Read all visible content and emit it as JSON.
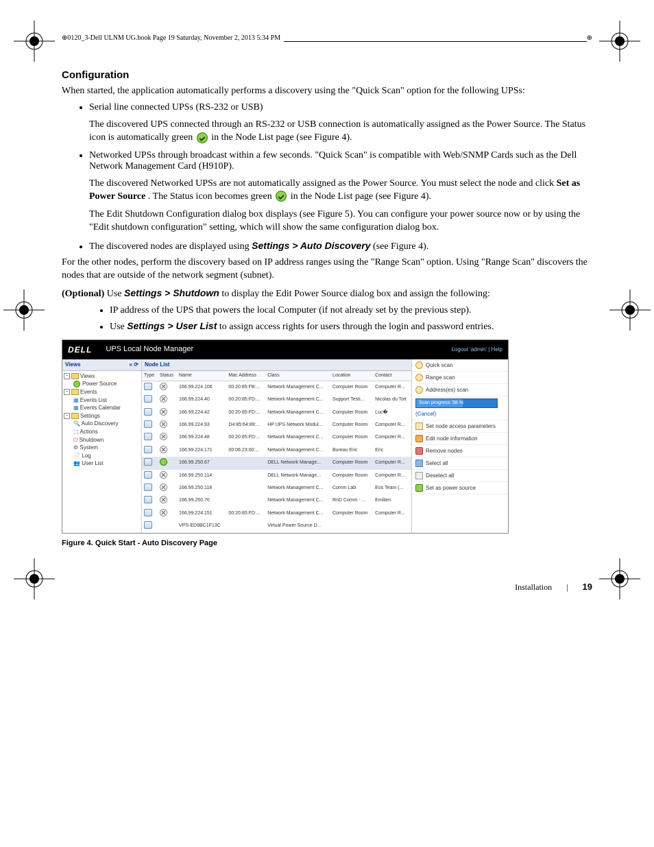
{
  "running_head": "0120_3-Dell ULNM UG.book  Page 19  Saturday, November 2, 2013  5:34 PM",
  "section_heading": "Configuration",
  "intro": "When started, the application automatically performs a discovery using the \"Quick Scan\" option for the following UPSs:",
  "bullet1_title": "Serial line connected UPSs (RS-232 or USB)",
  "bullet1_p1a": "The discovered UPS connected through an RS-232 or USB connection is automatically assigned as the Power Source. The Status icon is automatically green ",
  "bullet1_p1b": " in the Node List page (see Figure 4).",
  "bullet2_title": "Networked UPSs through broadcast within a few seconds. \"Quick Scan\" is compatible with Web/SNMP Cards such as the Dell Network Management Card (H910P).",
  "bullet2_p1a": "The discovered Networked UPSs are not automatically assigned as the Power Source. You must select the node and click ",
  "bullet2_p1_bold": "Set as Power Source",
  "bullet2_p1b": ". The Status icon becomes green ",
  "bullet2_p1c": " in the Node List page (see Figure 4).",
  "bullet2_p2": "The Edit Shutdown Configuration dialog box displays (see Figure 5). You can configure your power source now or by using the \"Edit shutdown configuration\" setting, which will show the same configuration dialog box.",
  "bullet3a": "The discovered nodes are displayed using ",
  "bullet3_path": "Settings > Auto Discovery",
  "bullet3b": " (see Figure 4).",
  "para2": "For the other nodes, perform the discovery based on IP address ranges using the \"Range Scan\" option. Using \"Range Scan\" discovers the nodes that are outside of the network segment (subnet).",
  "para3a_bold": "(Optional)",
  "para3a": " Use ",
  "para3_path": "Settings > Shutdown",
  "para3b": " to display the Edit Power Source dialog box and assign the following:",
  "sub1": "IP address of the UPS that powers the local Computer (if not already set by the previous step).",
  "sub2a": "Use ",
  "sub2_path": "Settings > User List",
  "sub2b": " to assign access rights for users through the login and password entries.",
  "figure_caption": "Figure 4.  Quick Start - Auto Discovery Page",
  "footer_label": "Installation",
  "footer_page": "19",
  "app": {
    "logo": "DELL",
    "title": "UPS Local Node Manager",
    "header_right": "Logout 'admin'   |  Help",
    "sidebar_title": "Views",
    "sidebar": {
      "views": "Views",
      "power_source": "Power Source",
      "events": "Events",
      "events_list": "Events List",
      "events_calendar": "Events Calendar",
      "settings": "Settings",
      "auto_discovery": "Auto Discovery",
      "actions": "Actions",
      "shutdown": "Shutdown",
      "system": "System",
      "log": "Log",
      "user_list": "User List"
    },
    "nodelist_title": "Node List",
    "columns": [
      "Type",
      "Status",
      "Name",
      "Mac Address",
      "Class",
      "Location",
      "Contact"
    ],
    "rows": [
      {
        "name": "166.99.224.106",
        "mac": "00:20:85:FB:...",
        "class": "Network Management C...",
        "loc": "Computer Room",
        "contact": "Computer R..."
      },
      {
        "name": "166.99.224.40",
        "mac": "00:20:85:FD:...",
        "class": "Network Management C...",
        "loc": "Support Testi...",
        "contact": "Nicolas du Toit"
      },
      {
        "name": "166.99.224.42",
        "mac": "00:20:85:FD:...",
        "class": "Network Management C...",
        "loc": "Computer Room",
        "contact": "Luc�"
      },
      {
        "name": "166.99.224.93",
        "mac": "D4:85:64:89:...",
        "class": "HP UPS Network Modul...",
        "loc": "Computer Room",
        "contact": "Computer R..."
      },
      {
        "name": "166.99.224.48",
        "mac": "00:20:85:FD:...",
        "class": "Network Management C...",
        "loc": "Computer Room",
        "contact": "Computer R..."
      },
      {
        "name": "166.99.224.171",
        "mac": "00:06:23:00:...",
        "class": "Network Management C...",
        "loc": "Bureau Eric",
        "contact": "Eric"
      },
      {
        "name": "166.99.250.67",
        "mac": "",
        "class": "DELL Network Manage...",
        "loc": "Computer Room",
        "contact": "Computer R...",
        "sel": true,
        "ok": true
      },
      {
        "name": "166.99.250.114",
        "mac": "",
        "class": "DELL Network Manage...",
        "loc": "Computer Room",
        "contact": "Computer R..."
      },
      {
        "name": "166.99.250.118",
        "mac": "",
        "class": "Network Management C...",
        "loc": "Comm Lab",
        "contact": "Eos Team (..."
      },
      {
        "name": "166.99.250.70",
        "mac": "",
        "class": "Network Management C...",
        "loc": "RnD Comm - ...",
        "contact": "Emilien"
      },
      {
        "name": "166.99.224.151",
        "mac": "00:20:85:FD:...",
        "class": "Network Management C...",
        "loc": "Computer Room",
        "contact": "Computer R..."
      },
      {
        "name": "VPS-ED9BC1F13C",
        "mac": "",
        "class": "Virtual Power Source D...",
        "loc": "",
        "contact": "",
        "vps": true
      }
    ],
    "right": {
      "quick_scan": "Quick scan",
      "range_scan": "Range scan",
      "address_scan": "Address(es) scan",
      "progress": "Scan progress: 58 %",
      "cancel": "(Cancel)",
      "set_params": "Set node access parameters",
      "edit_info": "Edit node information",
      "remove": "Remove nodes",
      "select_all": "Select all",
      "deselect_all": "Deselect all",
      "set_power": "Set as power source"
    }
  }
}
